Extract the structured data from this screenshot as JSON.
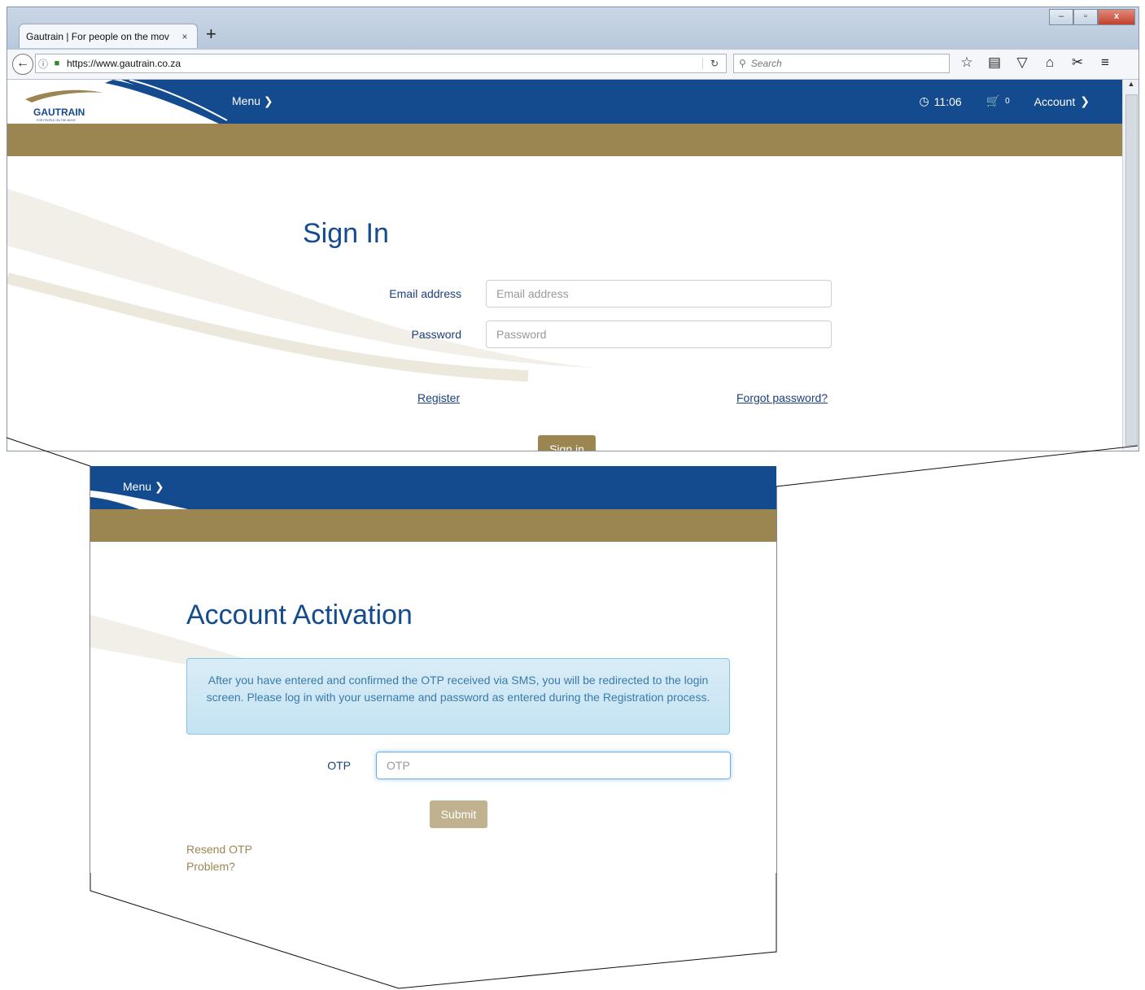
{
  "browser": {
    "tab_title": "Gautrain | For people on the mov",
    "tab_close": "×",
    "new_tab": "+",
    "url": "https://www.gautrain.co.za",
    "search_placeholder": "Search",
    "window_controls": [
      "minimize",
      "maximize",
      "close"
    ]
  },
  "header": {
    "logo_text": "GAUTRAIN",
    "logo_tagline": "FOR PEOPLE ON THE MOVE",
    "menu_label": "Menu",
    "time": "11:06",
    "cart_count": "0",
    "account_label": "Account"
  },
  "signin": {
    "title": "Sign In",
    "email_label": "Email address",
    "email_placeholder": "Email address",
    "password_label": "Password",
    "password_placeholder": "Password",
    "register_link": "Register",
    "forgot_link": "Forgot password?",
    "submit_label": "Sign in"
  },
  "activation": {
    "menu_label": "Menu",
    "title": "Account Activation",
    "info_text": "After you have entered and confirmed the OTP received via SMS, you will be redirected to the login screen. Please log in with your username and password as entered during the Registration process.",
    "otp_label": "OTP",
    "otp_placeholder": "OTP",
    "submit_label": "Submit",
    "resend_link": "Resend OTP",
    "problem_link": "Problem?"
  },
  "colors": {
    "brand_blue": "#144a8e",
    "brand_gold": "#9b8652",
    "info_bg": "#d9edf7"
  }
}
